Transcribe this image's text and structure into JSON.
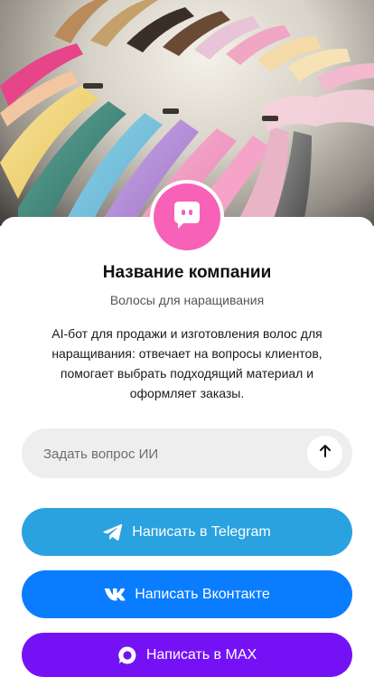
{
  "company": {
    "name": "Название компании",
    "subtitle": "Волосы для наращивания",
    "description": "AI-бот для продажи и изготовления волос для наращивания: отвечает на вопросы клиентов, помогает выбрать подходящий материал и оформляет заказы."
  },
  "ask": {
    "placeholder": "Задать вопрос ИИ",
    "send_icon": "arrow-up-icon"
  },
  "buttons": {
    "telegram": {
      "label": "Написать в Telegram",
      "icon": "telegram-icon",
      "color": "#2aa2e0"
    },
    "vk": {
      "label": "Написать Вконтакте",
      "icon": "vk-icon",
      "color": "#0a7dff"
    },
    "max": {
      "label": "Написать в MAX",
      "icon": "max-icon",
      "color": "#7512f5"
    }
  },
  "avatar": {
    "icon": "chat-bot-icon",
    "color": "#f761b8"
  },
  "hero": {
    "image": "hair-extensions-photo"
  }
}
